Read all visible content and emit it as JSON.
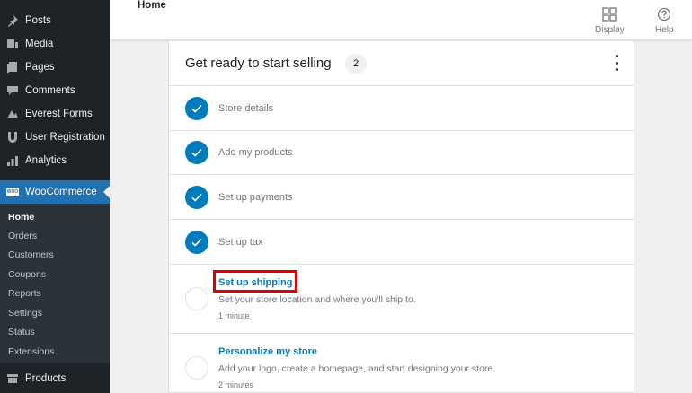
{
  "sidebar": {
    "items": [
      {
        "label": "Posts",
        "icon": "pin-icon"
      },
      {
        "label": "Media",
        "icon": "media-icon"
      },
      {
        "label": "Pages",
        "icon": "pages-icon"
      },
      {
        "label": "Comments",
        "icon": "comments-icon"
      },
      {
        "label": "Everest Forms",
        "icon": "everest-forms-icon"
      },
      {
        "label": "User Registration",
        "icon": "user-registration-icon"
      },
      {
        "label": "Analytics",
        "icon": "analytics-icon"
      }
    ],
    "woocommerce": {
      "label": "WooCommerce",
      "icon_text": "WOO"
    },
    "submenu": [
      "Home",
      "Orders",
      "Customers",
      "Coupons",
      "Reports",
      "Settings",
      "Status",
      "Extensions"
    ],
    "products": {
      "label": "Products",
      "icon": "products-icon"
    }
  },
  "header": {
    "title": "Home",
    "display_label": "Display",
    "help_label": "Help"
  },
  "card": {
    "title": "Get ready to start selling",
    "badge": "2",
    "completed_tasks": [
      "Store details",
      "Add my products",
      "Set up payments",
      "Set up tax"
    ],
    "pending_tasks": [
      {
        "title": "Set up shipping",
        "desc": "Set your store location and where you'll ship to.",
        "time": "1 minute"
      },
      {
        "title": "Personalize my store",
        "desc": "Add your logo, create a homepage, and start designing your store.",
        "time": "2 minutes"
      }
    ]
  },
  "colors": {
    "sidebar_bg": "#1d2327",
    "accent": "#2271b1",
    "check": "#007cba",
    "highlight": "#e00000"
  }
}
